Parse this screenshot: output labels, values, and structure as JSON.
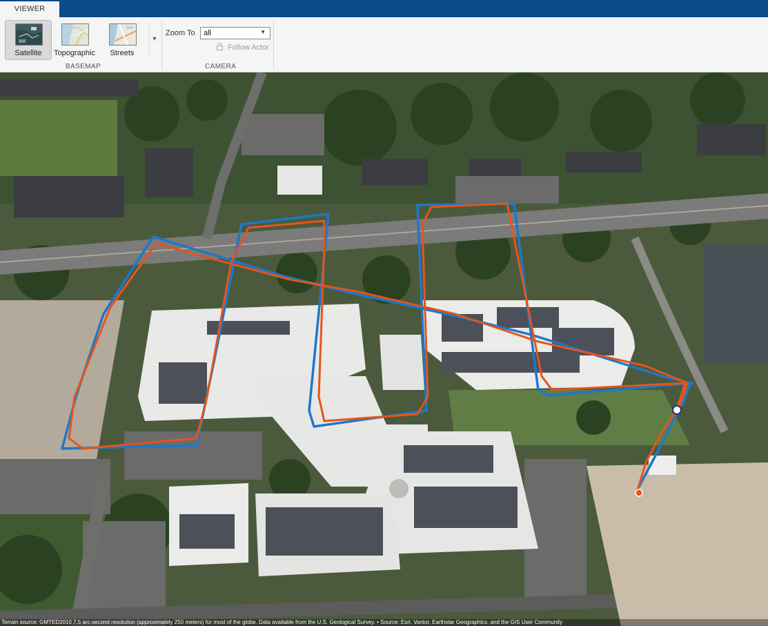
{
  "tab": {
    "label": "VIEWER"
  },
  "basemap": {
    "group_label": "BASEMAP",
    "options": [
      {
        "label": "Satellite",
        "selected": true
      },
      {
        "label": "Topographic",
        "selected": false
      },
      {
        "label": "Streets",
        "selected": false
      }
    ]
  },
  "camera": {
    "group_label": "CAMERA",
    "zoom_label": "Zoom To",
    "zoom_value": "all",
    "follow_actor_label": "Follow Actor",
    "follow_actor_enabled": false
  },
  "map": {
    "attribution": "Terrain source: GMTED2010 7.5 arc-second resolution (approximately 250 meters) for most of the globe. Data available from the U.S. Geological Survey. • Source: Esri, Vantor, Earthstar Geographics, and the GIS User Community",
    "colors": {
      "ground_truth_track": "#1f77c9",
      "estimated_track": "#e4551b"
    }
  }
}
